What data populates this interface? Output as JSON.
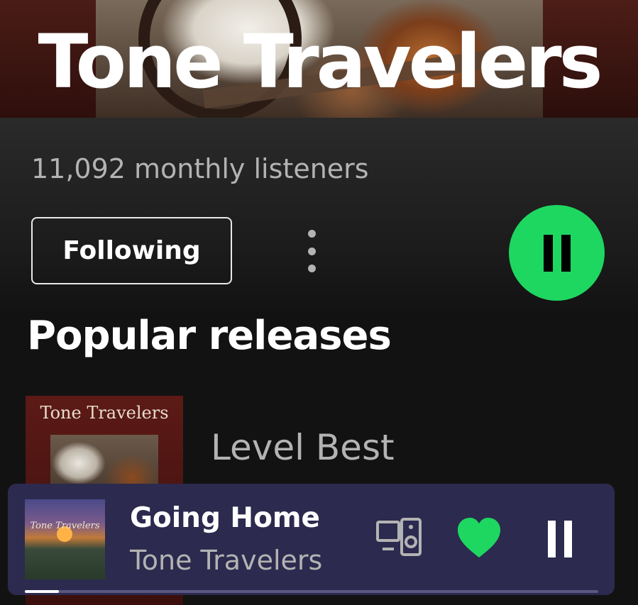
{
  "artist": {
    "name": "Tone Travelers",
    "monthly_listeners": "11,092 monthly listeners"
  },
  "actions": {
    "follow_label": "Following",
    "more_icon": "more-vertical-icon",
    "play_state": "playing",
    "play_icon": "pause-icon"
  },
  "popular_releases": {
    "title": "Popular releases",
    "items": [
      {
        "title": "Level Best",
        "cover_text": "Tone Travelers"
      }
    ]
  },
  "now_playing": {
    "title": "Going Home",
    "artist": "Tone Travelers",
    "art_text": "Tone Travelers",
    "art_subtext": "",
    "liked": true,
    "progress": 0.06,
    "icons": [
      "devices-icon",
      "heart-icon",
      "pause-icon"
    ]
  },
  "colors": {
    "accent": "#1ed760",
    "now_playing_bg": "#2c2a4e",
    "text_secondary": "#b3b3b3"
  }
}
